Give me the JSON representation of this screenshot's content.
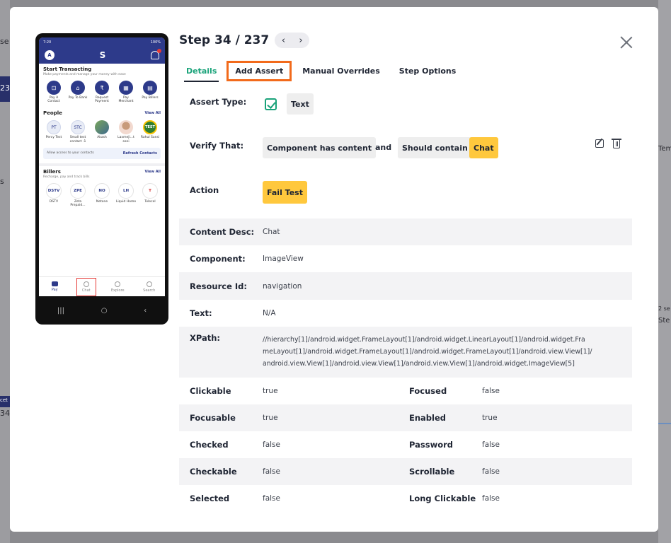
{
  "background": {
    "left_texts": [
      "se",
      "23",
      "s",
      "cet",
      "34"
    ],
    "right_texts": [
      "Tem",
      "2 se",
      "Ste"
    ]
  },
  "phone": {
    "status_time": "7:20",
    "status_right": "100%",
    "avatar_letter": "A",
    "logo": "S",
    "start_title": "Start Transacting",
    "start_sub": "Make payments and manage your money with ease",
    "transact_items": [
      {
        "label": "Pay A Contact",
        "glyph": "⊡"
      },
      {
        "label": "Pay To Bank",
        "glyph": "⌂"
      },
      {
        "label": "Request Payment",
        "glyph": "₹"
      },
      {
        "label": "Pay Merchant",
        "glyph": "▦"
      },
      {
        "label": "Pay Billers",
        "glyph": "▤"
      }
    ],
    "people_title": "People",
    "people_view_all": "View All",
    "people": [
      {
        "label": "Percy Test",
        "initials": "PT"
      },
      {
        "label": "Small test contact -1",
        "initials": "STC"
      },
      {
        "label": "Akash",
        "initials": ""
      },
      {
        "label": "Laxmeji...t soni",
        "initials": ""
      },
      {
        "label": "Rahul Sansi",
        "initials": "TEST"
      }
    ],
    "refresh_text": "Allow access to your contacts",
    "refresh_link": "Refresh Contacts",
    "billers_title": "Billers",
    "billers_sub": "Recharge, pay and track bills",
    "billers_view_all": "View All",
    "billers": [
      {
        "label": "DSTV",
        "logo": "DSTV"
      },
      {
        "label": "Zeta Prepaid...",
        "logo": "ZPE"
      },
      {
        "label": "Netone",
        "logo": "NO"
      },
      {
        "label": "Liquid Home",
        "logo": "LH"
      },
      {
        "label": "Telecel",
        "logo": "T"
      }
    ],
    "bottom_nav": [
      {
        "label": "Pay"
      },
      {
        "label": "Chat"
      },
      {
        "label": "Explore"
      },
      {
        "label": "Search"
      }
    ],
    "sys_nav": [
      "|||",
      "○",
      "‹"
    ]
  },
  "header": {
    "step_title": "Step 34 / 237",
    "prev": "‹",
    "next": "›"
  },
  "tabs": [
    "Details",
    "Add Assert",
    "Manual Overrides",
    "Step Options"
  ],
  "assert": {
    "type_label": "Assert Type:",
    "type_value": "Text",
    "verify_label": "Verify That:",
    "verify_chip1": "Component has content",
    "verify_and": "and",
    "verify_chip2": "Should contain",
    "verify_chip3": "Chat",
    "action_label": "Action",
    "action_value": "Fail Test"
  },
  "details": {
    "content_desc_label": "Content Desc:",
    "content_desc": "Chat",
    "component_label": "Component:",
    "component": "ImageView",
    "resource_label": "Resource Id:",
    "resource": "navigation",
    "text_label": "Text:",
    "text": "N/A",
    "xpath_label": "XPath:",
    "xpath_1": "//hierarchy[1]/android.widget.FrameLayout[1]/android.widget.LinearLayout[1]/android.widget.Fra",
    "xpath_2": "meLayout[1]/android.widget.FrameLayout[1]/android.widget.FrameLayout[1]/android.view.View[1]/",
    "xpath_3": "android.view.View[1]/android.view.View[1]/android.view.View[1]/android.widget.ImageView[5]"
  },
  "props": [
    {
      "l1": "Clickable",
      "v1": "true",
      "l2": "Focused",
      "v2": "false"
    },
    {
      "l1": "Focusable",
      "v1": "true",
      "l2": "Enabled",
      "v2": "true"
    },
    {
      "l1": "Checked",
      "v1": "false",
      "l2": "Password",
      "v2": "false"
    },
    {
      "l1": "Checkable",
      "v1": "false",
      "l2": "Scrollable",
      "v2": "false"
    },
    {
      "l1": "Selected",
      "v1": "false",
      "l2": "Long Clickable",
      "v2": "false"
    }
  ]
}
